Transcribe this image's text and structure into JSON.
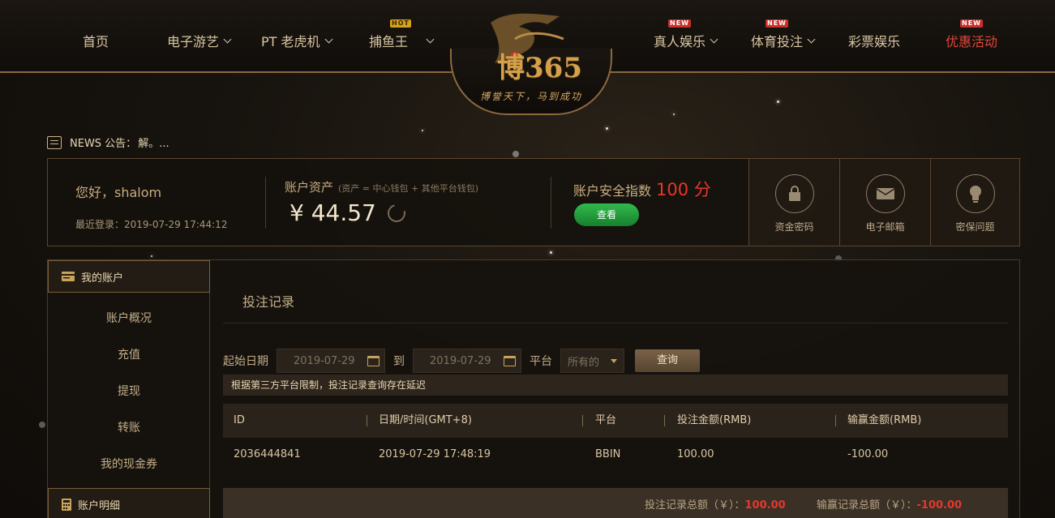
{
  "nav": {
    "left": [
      {
        "label": "首页"
      },
      {
        "label": "电子游艺",
        "dropdown": true
      },
      {
        "label": "PT 老虎机",
        "dropdown": true
      },
      {
        "label": "捕鱼王",
        "badge": "HOT",
        "dropdown": true
      }
    ],
    "right": [
      {
        "label": "真人娱乐",
        "badge": "NEW",
        "dropdown": true
      },
      {
        "label": "体育投注",
        "badge": "NEW",
        "dropdown": true
      },
      {
        "label": "彩票娱乐"
      },
      {
        "label": "优惠活动",
        "badge": "NEW",
        "color": "#e0473a"
      }
    ]
  },
  "logo": {
    "text": "博365",
    "slogan": "博誉天下，马到成功"
  },
  "news": {
    "label": "NEWS 公告：",
    "text": "解。..."
  },
  "account": {
    "greeting": "您好，shalom",
    "last_login": "最近登录：2019-07-29 17:44:12",
    "assets_label": "账户资产",
    "assets_note": "(资产 = 中心钱包 + 其他平台钱包)",
    "balance": "¥ 44.57",
    "security_label": "账户安全指数",
    "security_score": "100 分",
    "check_button": "查看",
    "security_items": [
      {
        "label": "资金密码",
        "icon": "lock-icon"
      },
      {
        "label": "电子邮箱",
        "icon": "mail-icon"
      },
      {
        "label": "密保问题",
        "icon": "bulb-icon"
      }
    ]
  },
  "sidebar": {
    "section1": "我的账户",
    "items": [
      "账户概况",
      "充值",
      "提现",
      "转账",
      "我的现金券"
    ],
    "section2": "账户明细"
  },
  "main": {
    "title": "投注记录",
    "filter": {
      "start_label": "起始日期",
      "start_date": "2019-07-29",
      "to_label": "到",
      "end_date": "2019-07-29",
      "platform_label": "平台",
      "platform_value": "所有的",
      "query_button": "查询"
    },
    "notice": "根据第三方平台限制，投注记录查询存在延迟",
    "columns": [
      "ID",
      "日期/时间(GMT+8)",
      "平台",
      "投注金额(RMB)",
      "输赢金额(RMB)"
    ],
    "rows": [
      {
        "id": "2036444841",
        "datetime": "2019-07-29 17:48:19",
        "platform": "BBIN",
        "bet": "100.00",
        "winloss": "-100.00"
      }
    ],
    "totals": {
      "bet_label": "投注记录总额（￥）：",
      "bet_value": "100.00",
      "winloss_label": "输赢记录总额（￥）：",
      "winloss_value": "-100.00"
    }
  },
  "colors": {
    "accent_gold": "#c8a35a",
    "red": "#e5382c",
    "green": "#1f9a38"
  }
}
